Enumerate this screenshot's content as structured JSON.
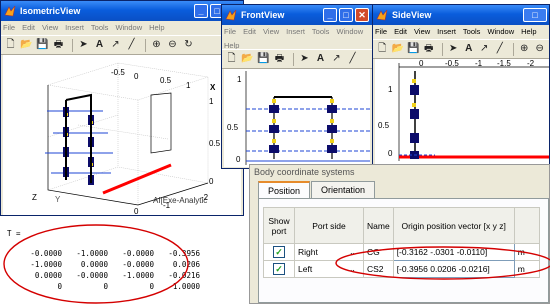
{
  "isometric": {
    "title": "IsometricView",
    "menu": [
      "File",
      "Edit",
      "View",
      "Insert",
      "Tools",
      "Window",
      "Help"
    ],
    "tick_top": [
      "-0.5",
      "0",
      "0.5",
      "1"
    ],
    "tick_right": [
      "0",
      "-0.5",
      "-1",
      "-1.5",
      "-2"
    ],
    "tick_y": [
      "1",
      "0.5",
      "0"
    ],
    "tick_x": [
      "0",
      "-1",
      "-2"
    ],
    "axis_x": "X",
    "axis_z": "Z",
    "axis_y": "Y",
    "caption": "AI[Exe-Analytic"
  },
  "front": {
    "title": "FrontView",
    "menu": [
      "File",
      "Edit",
      "View",
      "Insert",
      "Tools",
      "Window",
      "Help"
    ],
    "ticks": [
      "1",
      "0.5",
      "0"
    ]
  },
  "side": {
    "title": "SideView",
    "menu": [
      "File",
      "Edit",
      "View",
      "Insert",
      "Tools",
      "Window",
      "Help"
    ],
    "ticks_top": [
      "0",
      "-0.5",
      "-1",
      "-1.5",
      "-2"
    ],
    "ticks_left": [
      "1",
      "0.5",
      "0"
    ]
  },
  "bcs": {
    "title": "Body coordinate systems",
    "tabs": [
      "Position",
      "Orientation"
    ],
    "headers": {
      "show": "Show port",
      "side": "Port side",
      "name": "Name",
      "origin": "Origin position vector [x y z]"
    },
    "rows": [
      {
        "show": true,
        "side": "Right",
        "name": "CG",
        "vector": "[-0.3162 -.0301 -0.0110]",
        "unit": "m"
      },
      {
        "show": true,
        "side": "Left",
        "name": "CS2",
        "vector": "[-0.3956 0.0206 -0.0216]",
        "unit": "m"
      }
    ]
  },
  "matrix": {
    "label": "T =",
    "rows": [
      [
        "-0.0000",
        "-1.0000",
        "-0.0000",
        "-0.3956"
      ],
      [
        "-1.0000",
        "0.0000",
        "-0.0000",
        "0.0206"
      ],
      [
        "0.0000",
        "-0.0000",
        "-1.0000",
        "-0.0216"
      ],
      [
        "0",
        "0",
        "0",
        "1.0000"
      ]
    ]
  },
  "colors": {
    "titlebar": "#0a5ddc",
    "highlight_ellipse": "#d40000",
    "rail": "#ff0000",
    "close": "#d24b2a"
  }
}
